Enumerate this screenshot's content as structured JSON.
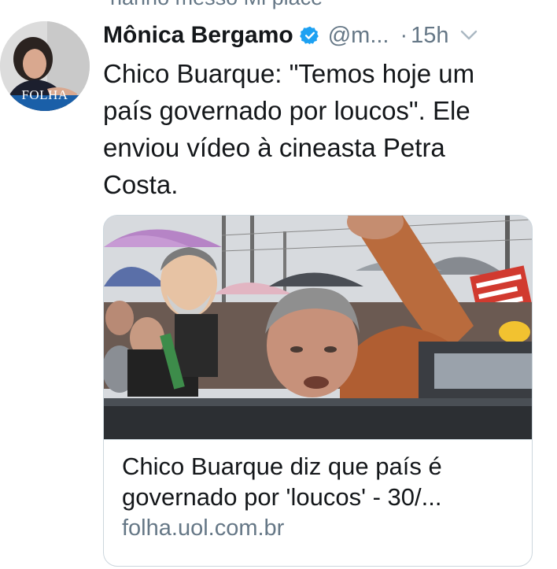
{
  "context": {
    "text": "hanno messo Mi place"
  },
  "tweet": {
    "avatar_label": "FOLHA",
    "display_name": "Mônica Bergamo",
    "verified_icon": "verified-badge-icon",
    "handle": "@m...",
    "separator": "·",
    "time": "15h",
    "menu_icon": "chevron-down-icon",
    "text_lines": [
      "Chico Buarque: \"Temos hoje um",
      "país governado por loucos\". Ele",
      "enviou vídeo à cineasta Petra",
      "Costa."
    ]
  },
  "card": {
    "image_alt": "photo-crowd-in-rain",
    "title_lines": [
      "Chico Buarque diz que país é",
      "governado por 'loucos' - 30/..."
    ],
    "domain": "folha.uol.com.br"
  },
  "colors": {
    "text": "#14171a",
    "secondary": "#657786",
    "verified": "#1da1f2",
    "border": "#ccd6dd",
    "folha_blue": "#1a5fa8"
  }
}
